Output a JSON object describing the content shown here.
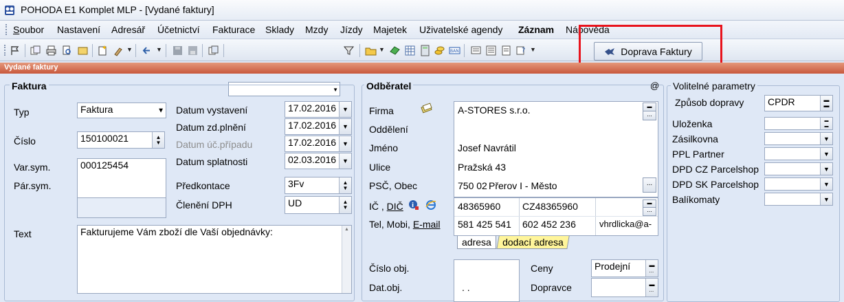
{
  "window": {
    "title": "POHODA E1 Komplet MLP - [Vydané faktury]"
  },
  "menu": {
    "items": [
      "Soubor",
      "Nastavení",
      "Adresář",
      "Účetnictví",
      "Fakturace",
      "Sklady",
      "Mzdy",
      "Jízdy",
      "Majetek",
      "Uživatelské agendy",
      "Záznam",
      "Nápověda"
    ]
  },
  "toolbar": {
    "doprava_button": "Doprava Faktury",
    "search_value": ""
  },
  "section": {
    "title": "Vydané faktury"
  },
  "faktura": {
    "group_title": "Faktura",
    "typ_label": "Typ",
    "typ_value": "Faktura",
    "cislo_label": "Číslo",
    "cislo_value": "150100021",
    "varsym_label": "Var.sym.",
    "varsym_value": "000125454",
    "parsym_label": "Pár.sym.",
    "text_label": "Text",
    "text_value": "Fakturujeme Vám zboží dle Vaší objednávky:",
    "datum_vystaveni_label": "Datum vystavení",
    "datum_vystaveni_value": "17.02.2016",
    "datum_zdplneni_label": "Datum zd.plnění",
    "datum_zdplneni_value": "17.02.2016",
    "datum_ucpripadu_label": "Datum úč.případu",
    "datum_ucpripadu_value": "17.02.2016",
    "datum_splatnosti_label": "Datum splatnosti",
    "datum_splatnosti_value": "02.03.2016",
    "predkontace_label": "Předkontace",
    "predkontace_value": "3Fv",
    "cleneni_label": "Členění DPH",
    "cleneni_value": "UD"
  },
  "odberatel": {
    "group_title": "Odběratel",
    "at_sign": "@",
    "firma_label": "Firma",
    "firma_value": "A-STORES s.r.o.",
    "oddeleni_label": "Oddělení",
    "jmeno_label": "Jméno",
    "jmeno_value": "Josef Navrátil",
    "ulice_label": "Ulice",
    "ulice_value": "Pražská 43",
    "psc_label": "PSČ, Obec",
    "psc_value": "750 02",
    "obec_value": "Přerov I - Město",
    "ic_label": "IČ",
    "dic_label": "DIČ",
    "ic_value": "48365960",
    "dic_value": "CZ48365960",
    "tel_label": "Tel,  Mobi,",
    "email_label": "E-mail",
    "tel_value": "581 425 541",
    "mobil_value": "602 452 236",
    "email_value": "vhrdlicka@a-",
    "tab_adresa": "adresa",
    "tab_dodaci": "dodací adresa",
    "cislo_obj_label": "Číslo obj.",
    "dat_obj_label": "Dat.obj.",
    "dat_obj_value": ". .",
    "ceny_label": "Ceny",
    "ceny_value": "Prodejní",
    "dopravce_label": "Dopravce"
  },
  "volitelne": {
    "group_title": "Volitelné parametry",
    "zpusob_label": "Způsob dopravy",
    "zpusob_value": "CPDR",
    "rows": [
      {
        "label": "Uloženka",
        "kind": "spin"
      },
      {
        "label": "Zásilkovna",
        "kind": "dropdown"
      },
      {
        "label": "PPL Partner",
        "kind": "dropdown"
      },
      {
        "label": "DPD CZ Parcelshop",
        "kind": "dropdown"
      },
      {
        "label": "DPD SK Parcelshop",
        "kind": "dropdown"
      },
      {
        "label": "Balíkomaty",
        "kind": "dropdown"
      }
    ]
  },
  "colors": {
    "highlight": "#e8131c",
    "section_bar": "#c8583c",
    "tab_yellow": "#fff59a"
  }
}
